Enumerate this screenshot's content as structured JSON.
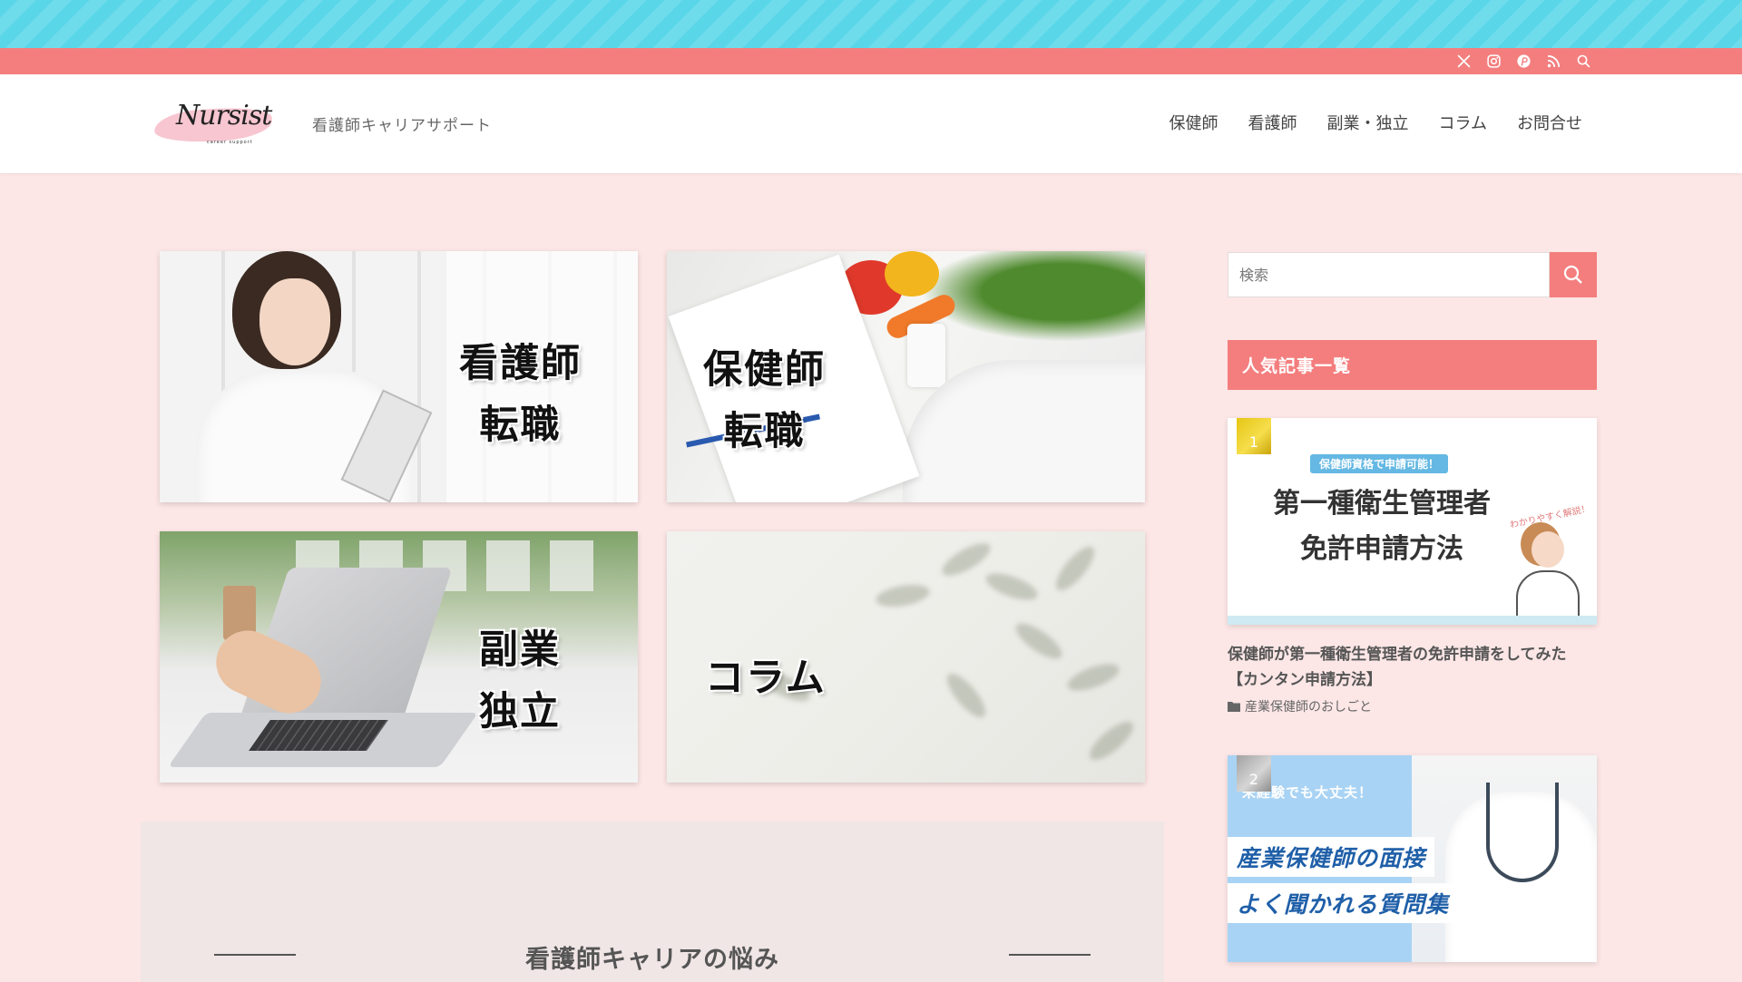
{
  "header": {
    "logo_text": "Nursist",
    "logo_sub": "career support",
    "tagline": "看護師キャリアサポート",
    "nav": [
      {
        "label": "保健師"
      },
      {
        "label": "看護師"
      },
      {
        "label": "副業・独立"
      },
      {
        "label": "コラム"
      },
      {
        "label": "お問合せ"
      }
    ],
    "social_icons": [
      "x-icon",
      "instagram-icon",
      "pinterest-icon",
      "rss-icon",
      "search-icon"
    ]
  },
  "categories": [
    {
      "line1": "看護師",
      "line2": "転職"
    },
    {
      "line1": "保健師",
      "line2": "転職"
    },
    {
      "line1": "副業",
      "line2": "独立"
    },
    {
      "line1": "コラム",
      "line2": ""
    }
  ],
  "section": {
    "title": "看護師キャリアの悩み"
  },
  "sidebar": {
    "search_placeholder": "検索",
    "popular_heading": "人気記事一覧",
    "rank1": {
      "rank": "1",
      "pill": "保健師資格で申請可能！",
      "thumb_line1": "第一種衛生管理者",
      "thumb_line2": "免許申請方法",
      "thumb_note": "わかりやすく解説！",
      "caption": "保健師が第一種衛生管理者の免許申請をしてみた【カンタン申請方法】",
      "category": "産業保健師のおしごと"
    },
    "rank2": {
      "rank": "2",
      "bubble": "未経験でも大丈夫！",
      "thumb_line1": "産業保健師の面接",
      "thumb_line2": "よく聞かれる質問集"
    }
  },
  "colors": {
    "accent": "#f47e7e",
    "stripe": "#5ad6e9",
    "page_bg": "#fce6e6"
  }
}
